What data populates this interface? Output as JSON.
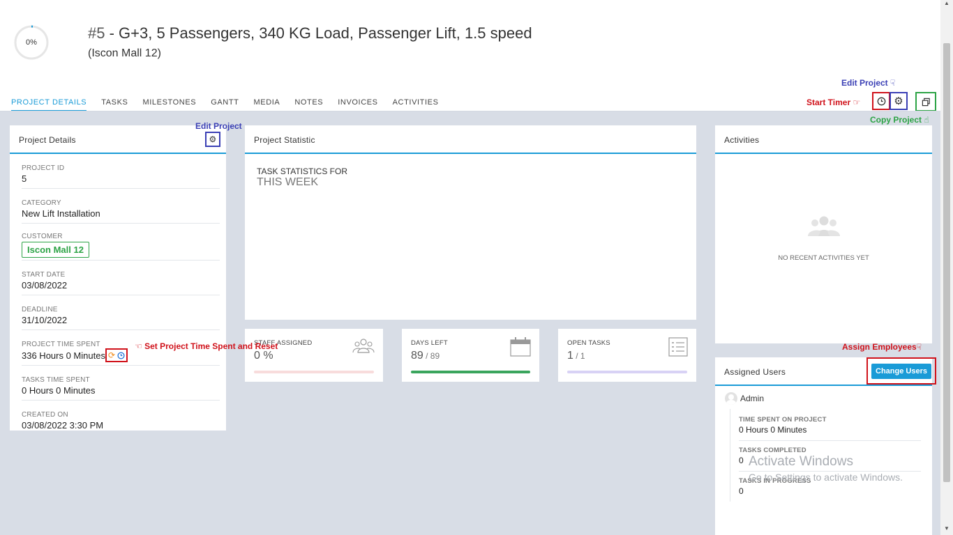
{
  "project": {
    "progress_label": "0%",
    "progress_value": 0,
    "title_number": "#5",
    "title_text": " - G+3, 5 Passengers, 340 KG Load, Passenger Lift, 1.5 speed",
    "subtitle": "(Iscon Mall 12)"
  },
  "tabs": [
    "PROJECT DETAILS",
    "TASKS",
    "MILESTONES",
    "GANTT",
    "MEDIA",
    "NOTES",
    "INVOICES",
    "ACTIVITIES"
  ],
  "annotations": {
    "edit_project_top": "Edit Project",
    "start_timer": "Start Timer",
    "copy_project": "Copy Project",
    "edit_project_panel": "Edit Project",
    "set_time": "Set Project Time Spent and Reset",
    "assign_employees": "Assign Employees"
  },
  "details": {
    "title": "Project Details",
    "project_id_label": "PROJECT ID",
    "project_id": "5",
    "category_label": "CATEGORY",
    "category": "New Lift Installation",
    "customer_label": "CUSTOMER",
    "customer": "Iscon Mall 12",
    "start_label": "START DATE",
    "start": "03/08/2022",
    "deadline_label": "DEADLINE",
    "deadline": "31/10/2022",
    "time_spent_label": "PROJECT TIME SPENT",
    "time_spent": "336 Hours 0 Minutes",
    "tasks_time_label": "TASKS TIME SPENT",
    "tasks_time": "0 Hours 0 Minutes",
    "created_label": "CREATED ON",
    "created": "03/08/2022 3:30 PM"
  },
  "statistic": {
    "title": "Project Statistic",
    "line1": "TASK STATISTICS FOR",
    "line2": "THIS WEEK"
  },
  "cards": {
    "staff_label": "STAFF ASSIGNED",
    "staff_value": "0 %",
    "days_label": "DAYS LEFT",
    "days_value": "89",
    "days_total": " / 89",
    "days_ratio": 1,
    "open_label": "OPEN TASKS",
    "open_value": "1",
    "open_total": " / 1",
    "open_ratio": 1,
    "colors": {
      "staff": "#f8dcdc",
      "days": "#3aa55d",
      "open": "#d8d2f5"
    }
  },
  "activities": {
    "title": "Activities",
    "empty": "NO RECENT ACTIVITIES YET"
  },
  "assigned": {
    "title": "Assigned Users",
    "button": "Change Users",
    "user": "Admin",
    "time_label": "TIME SPENT ON PROJECT",
    "time_value": "0 Hours 0 Minutes",
    "completed_label": "TASKS COMPLETED",
    "completed_value": "0",
    "progress_label": "TASKS IN PROGRESS",
    "progress_value": "0"
  },
  "watermark": {
    "title": "Activate Windows",
    "sub": "Go to Settings to activate Windows."
  },
  "colors": {
    "accent": "#1a9bd7",
    "customer": "#2ca345",
    "button": "#1a9bd7"
  }
}
